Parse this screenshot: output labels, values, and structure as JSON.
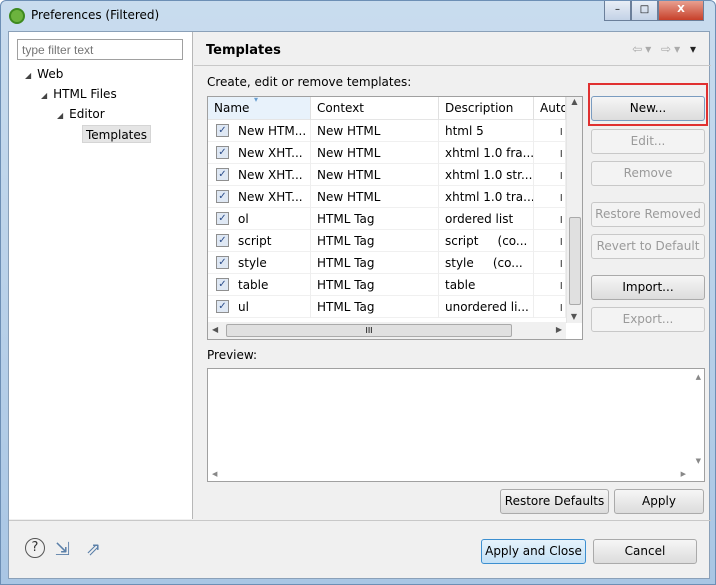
{
  "window": {
    "title": "Preferences (Filtered)",
    "minimize": "–",
    "maximize": "□",
    "close": "X"
  },
  "sidebar": {
    "filter_placeholder": "type filter text",
    "tree": [
      {
        "label": "Web"
      },
      {
        "label": "HTML Files"
      },
      {
        "label": "Editor"
      },
      {
        "label": "Templates",
        "selected": true
      }
    ]
  },
  "page": {
    "title": "Templates",
    "subtitle": "Create, edit or remove templates:",
    "preview_label": "Preview:"
  },
  "table": {
    "columns": [
      "Name",
      "Context",
      "Description",
      "Auto"
    ],
    "rows": [
      {
        "checked": true,
        "name": "New HTM...",
        "context": "New HTML",
        "description": "html 5"
      },
      {
        "checked": true,
        "name": "New XHT...",
        "context": "New HTML",
        "description": "xhtml 1.0 fra..."
      },
      {
        "checked": true,
        "name": "New XHT...",
        "context": "New HTML",
        "description": "xhtml 1.0 str..."
      },
      {
        "checked": true,
        "name": "New XHT...",
        "context": "New HTML",
        "description": "xhtml 1.0 tra..."
      },
      {
        "checked": true,
        "name": "ol",
        "context": "HTML Tag",
        "description": "ordered list"
      },
      {
        "checked": true,
        "name": "script",
        "context": "HTML Tag",
        "description": "script     (co..."
      },
      {
        "checked": true,
        "name": "style",
        "context": "HTML Tag",
        "description": "style     (co..."
      },
      {
        "checked": true,
        "name": "table",
        "context": "HTML Tag",
        "description": "table"
      },
      {
        "checked": true,
        "name": "ul",
        "context": "HTML Tag",
        "description": "unordered li..."
      }
    ]
  },
  "buttons": {
    "new": "New...",
    "edit": "Edit...",
    "remove": "Remove",
    "restore_removed": "Restore Removed",
    "revert": "Revert to Default",
    "import": "Import...",
    "export": "Export...",
    "restore_defaults": "Restore Defaults",
    "apply": "Apply",
    "apply_close": "Apply and Close",
    "cancel": "Cancel"
  },
  "colors": {
    "highlight": "#e03030"
  }
}
